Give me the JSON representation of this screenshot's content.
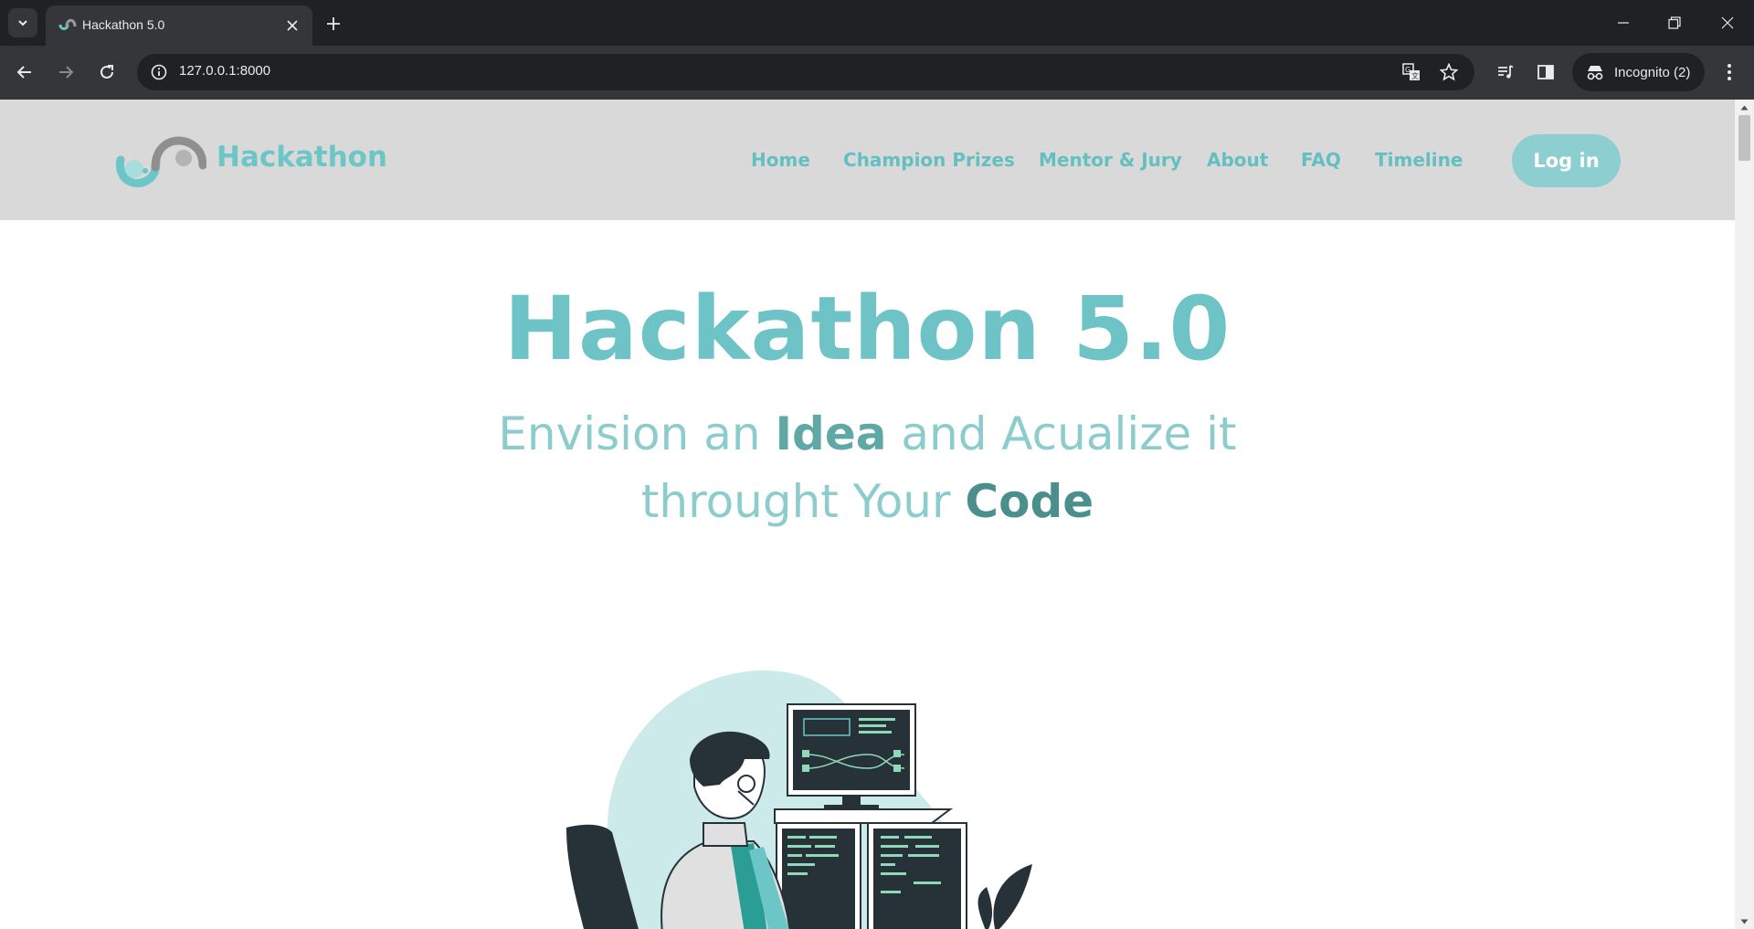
{
  "browser": {
    "tab": {
      "title": "Hackathon 5.0"
    },
    "url": "127.0.0.1:8000",
    "profile_label": "Incognito (2)",
    "icons": [
      "tab-search-icon",
      "close-icon",
      "plus-icon",
      "minimize-icon",
      "restore-icon",
      "back-icon",
      "forward-icon",
      "reload-icon",
      "site-info-icon",
      "translate-icon",
      "star-icon",
      "media-icon",
      "side-panel-icon",
      "incognito-icon",
      "more-icon"
    ]
  },
  "site": {
    "logo_text": "Hackathon",
    "nav": [
      {
        "label": "Home"
      },
      {
        "label": "Champion Prizes"
      },
      {
        "label": "Mentor & Jury"
      },
      {
        "label": "About"
      },
      {
        "label": "FAQ"
      },
      {
        "label": "Timeline"
      }
    ],
    "login_label": "Log in",
    "colors": {
      "header_bg": "#d9d9d9",
      "accent": "#6cc6c7",
      "button_bg": "#8dcfd0"
    }
  },
  "hero": {
    "title": "Hackathon 5.0",
    "line1_a": "Envision an ",
    "line1_b": "Idea",
    "line1_c": " and Acualize it",
    "line2_a": "throught Your ",
    "line2_b": "Code"
  }
}
